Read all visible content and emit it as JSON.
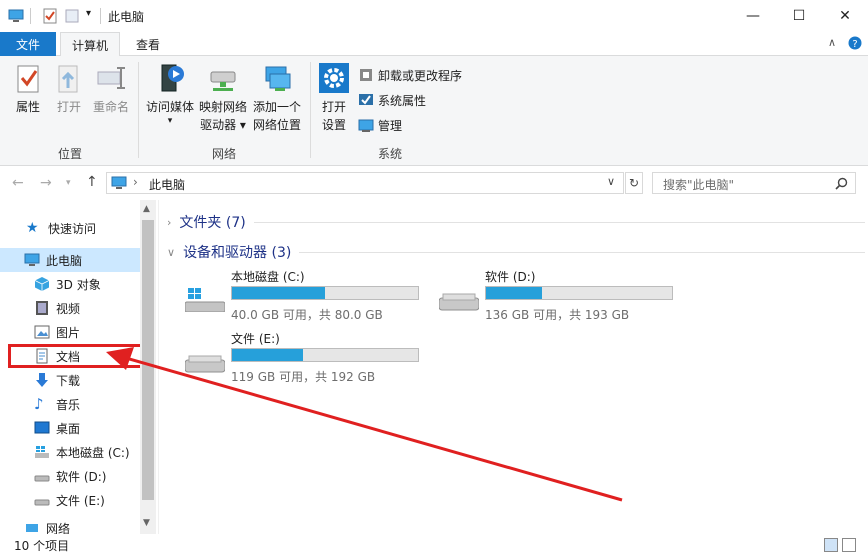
{
  "window": {
    "title": "此电脑",
    "minimize_icon": "—",
    "maximize_icon": "☐",
    "close_icon": "✕"
  },
  "ribbon_tabs": {
    "file": "文件",
    "computer": "计算机",
    "view": "查看"
  },
  "ribbon": {
    "location_group": {
      "label": "位置",
      "properties": "属性",
      "open": "打开",
      "rename": "重命名"
    },
    "network_group": {
      "label": "网络",
      "access_media": "访问媒体",
      "map_drive_line1": "映射网络",
      "map_drive_line2": "驱动器",
      "add_location_line1": "添加一个",
      "add_location_line2": "网络位置"
    },
    "system_group": {
      "label": "系统",
      "open_settings_line1": "打开",
      "open_settings_line2": "设置",
      "uninstall": "卸载或更改程序",
      "system_properties": "系统属性",
      "manage": "管理"
    }
  },
  "address_bar": {
    "path": "此电脑",
    "separator": "›"
  },
  "search": {
    "placeholder": "搜索\"此电脑\""
  },
  "nav": {
    "quick_access": "快速访问",
    "this_pc": "此电脑",
    "items": [
      "3D 对象",
      "视频",
      "图片",
      "文档",
      "下载",
      "音乐",
      "桌面",
      "本地磁盘 (C:)",
      "软件 (D:)",
      "文件 (E:)"
    ],
    "network": "网络"
  },
  "content": {
    "folders_header": "文件夹 (7)",
    "devices_header": "设备和驱动器 (3)",
    "drives": [
      {
        "name": "本地磁盘 (C:)",
        "detail": "40.0 GB 可用，共 80.0 GB",
        "used_fraction": 0.5
      },
      {
        "name": "软件 (D:)",
        "detail": "136 GB 可用，共 193 GB",
        "used_fraction": 0.3
      },
      {
        "name": "文件 (E:)",
        "detail": "119 GB 可用，共 192 GB",
        "used_fraction": 0.38
      }
    ]
  },
  "status_bar": {
    "item_count": "10 个项目"
  },
  "colors": {
    "accent": "#1979ca",
    "bar_fill": "#26a0da",
    "annotation": "#e02020"
  }
}
